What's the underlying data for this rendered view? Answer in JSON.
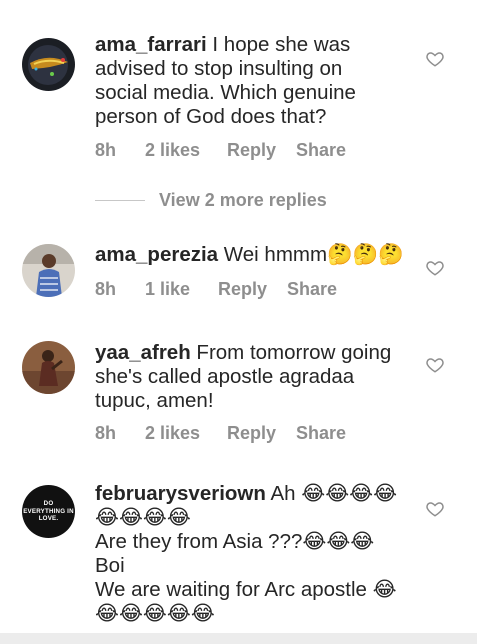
{
  "comments": [
    {
      "username": "ama_farrari",
      "text_lines": [
        " I hope she was",
        "advised to stop insulting on",
        "social media.  Which genuine",
        "person of God does that?"
      ],
      "time": "8h",
      "likes": "2 likes",
      "reply": "Reply",
      "share": "Share"
    },
    {
      "username": "ama_perezia",
      "text_lines": [
        " Wei hmmm🤔🤔🤔"
      ],
      "time": "8h",
      "likes": "1 like",
      "reply": "Reply",
      "share": "Share"
    },
    {
      "username": "yaa_afreh",
      "text_lines": [
        " From tomorrow going",
        "she's called apostle agradaa",
        "tupuc, amen!"
      ],
      "time": "8h",
      "likes": "2 likes",
      "reply": "Reply",
      "share": "Share"
    },
    {
      "username": "februarysveriown",
      "text_lines": [
        " Ah 😂😂😂😂",
        "😂😂😂😂",
        "Are they from Asia ???😂😂😂",
        "Boi",
        "We are waiting for Arc apostle 😂",
        "😂😂😂😂😂"
      ],
      "avatar_logo": "DO EVERYTHING IN LOVE."
    }
  ],
  "view_replies": "View 2 more replies",
  "icons": {
    "like": "heart-outline-icon"
  }
}
